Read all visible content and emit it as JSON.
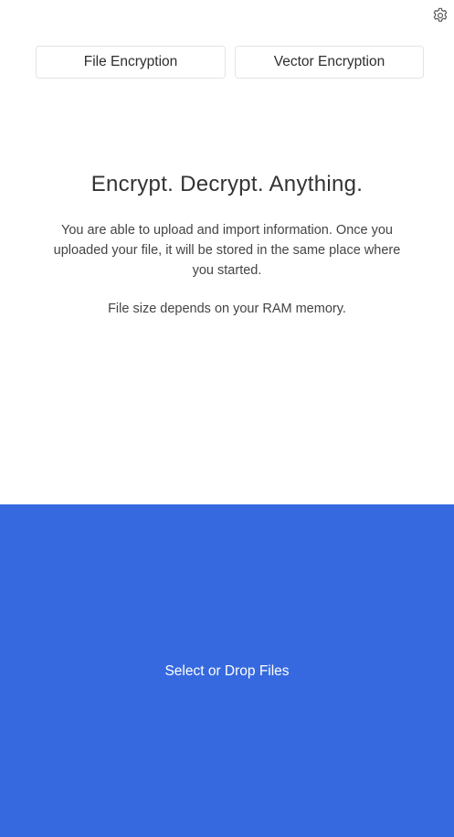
{
  "header": {
    "settings_icon": "gear-icon"
  },
  "tabs": [
    {
      "label": "File Encryption"
    },
    {
      "label": "Vector Encryption"
    }
  ],
  "hero": {
    "headline": "Encrypt. Decrypt. Anything.",
    "description": "You are able to upload and import information. Once you uploaded your file, it will be stored in the same place where you started.",
    "note": "File size depends on your RAM memory."
  },
  "dropzone": {
    "label": "Select or Drop Files",
    "background": "#3669df"
  }
}
